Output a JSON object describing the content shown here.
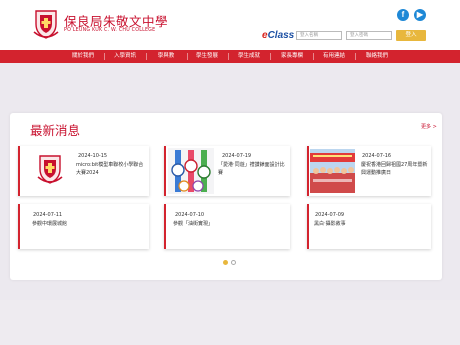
{
  "header": {
    "school_name_zh": "保良局朱敬文中學",
    "school_name_en": "PO LEUNG KUK C. W. CHU COLLEGE",
    "eclass_e": "e",
    "eclass_rest": "Class",
    "login_id_placeholder": "登入名稱",
    "login_pw_placeholder": "登入密碼",
    "login_button": "登入",
    "social_fb": "f",
    "social_yt": "▶"
  },
  "nav": {
    "items": [
      {
        "label": "關於我們"
      },
      {
        "label": "入學資訊"
      },
      {
        "label": "學與教"
      },
      {
        "label": "學生發展"
      },
      {
        "label": "學生成就"
      },
      {
        "label": "家長專欄"
      },
      {
        "label": "有用連結"
      },
      {
        "label": "聯絡我們"
      }
    ]
  },
  "news": {
    "title": "最新消息",
    "more": "更多 >",
    "cards": [
      {
        "date": "2024-10-15",
        "title": "micro:bit模型車聯校小學聯合大賽2024"
      },
      {
        "date": "2024-07-19",
        "title": "「愛港‧同遊」禮讚錶面設計比賽"
      },
      {
        "date": "2024-07-16",
        "title": "慶祝香港回歸祖國27周年暨新興運動推廣日"
      },
      {
        "date": "2024-07-11",
        "title": "參觀中環展城館"
      },
      {
        "date": "2024-07-10",
        "title": "參觀「油街實現」"
      },
      {
        "date": "2024-07-09",
        "title": "黑白‧攝影敘事"
      }
    ]
  },
  "colors": {
    "brand_red": "#d3232e",
    "accent_gold": "#e8b73d",
    "social_blue": "#1e88d6"
  }
}
